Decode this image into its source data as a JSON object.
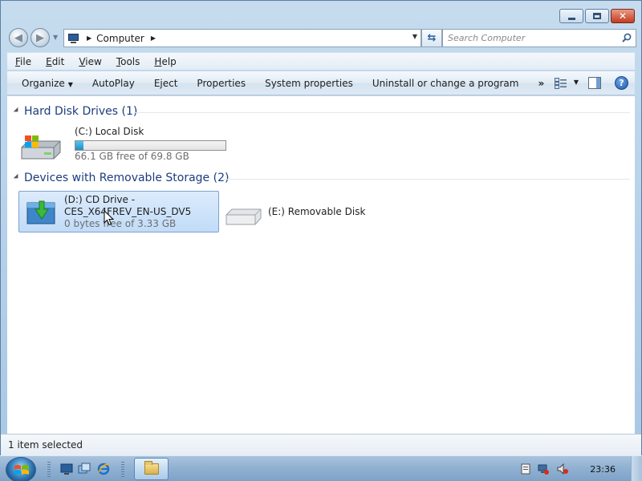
{
  "window": {
    "controls": {
      "minimize": "minimize",
      "maximize": "maximize",
      "close": "✕"
    }
  },
  "address_bar": {
    "breadcrumb": "Computer",
    "search_placeholder": "Search Computer"
  },
  "menu": {
    "items": [
      {
        "label_u": "F",
        "label_rest": "ile"
      },
      {
        "label_u": "E",
        "label_rest": "dit"
      },
      {
        "label_u": "V",
        "label_rest": "iew"
      },
      {
        "label_u": "T",
        "label_rest": "ools"
      },
      {
        "label_u": "H",
        "label_rest": "elp"
      }
    ]
  },
  "command_bar": {
    "organize": "Organize",
    "autoplay": "AutoPlay",
    "eject": "Eject",
    "properties": "Properties",
    "system_properties": "System properties",
    "uninstall": "Uninstall or change a program",
    "more": "»",
    "help": "?"
  },
  "groups": {
    "hard_disks": {
      "title": "Hard Disk Drives (1)"
    },
    "removable": {
      "title": "Devices with Removable Storage (2)"
    }
  },
  "drives": {
    "c": {
      "label": "(C:) Local Disk",
      "free_text": "66.1 GB free of 69.8 GB",
      "used_fraction": 0.053
    },
    "d": {
      "label_line1": "(D:) CD Drive -",
      "label_line2": "CES_X64FREV_EN-US_DV5",
      "free_text": "0 bytes free of 3.33 GB"
    },
    "e": {
      "label": "(E:) Removable Disk"
    }
  },
  "status": {
    "text": "1 item selected"
  },
  "taskbar": {
    "clock": "23:36"
  },
  "colors": {
    "accent": "#1b3d7e",
    "selection": "#c1dcf8",
    "capacity_fill": "#1f8fc8"
  }
}
